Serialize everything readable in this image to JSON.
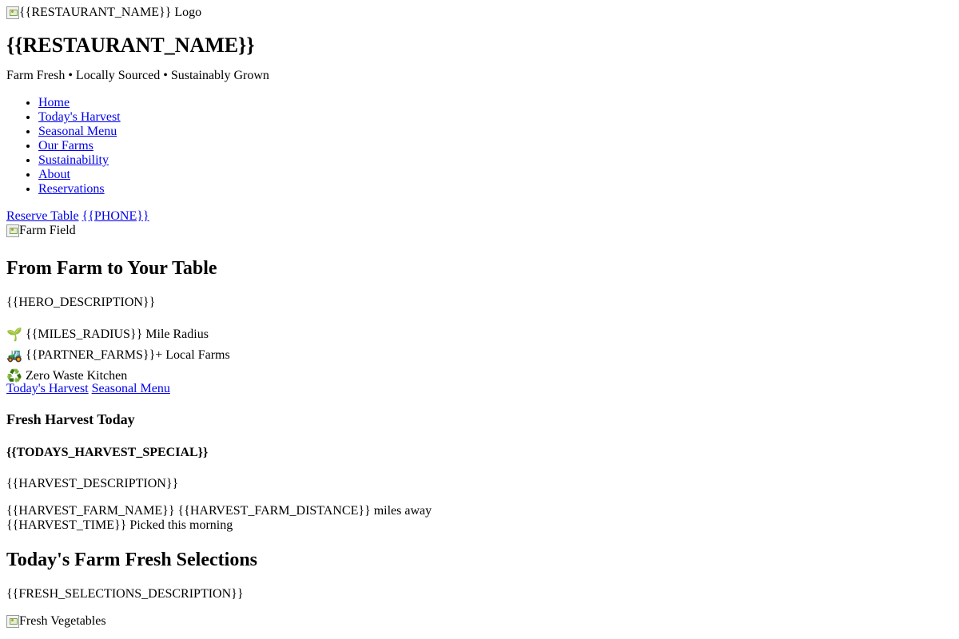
{
  "header": {
    "logo_alt": "{{RESTAURANT_NAME}} Logo",
    "restaurant_name": "{{RESTAURANT_NAME}}",
    "tagline": "Farm Fresh • Locally Sourced • Sustainably Grown",
    "nav": [
      {
        "label": "Home"
      },
      {
        "label": "Today's Harvest"
      },
      {
        "label": "Seasonal Menu"
      },
      {
        "label": "Our Farms"
      },
      {
        "label": "Sustainability"
      },
      {
        "label": "About"
      },
      {
        "label": "Reservations"
      }
    ],
    "reserve_label": "Reserve Table",
    "phone_label": "{{PHONE}}"
  },
  "hero": {
    "image_alt": "Farm Field",
    "title": "From Farm to Your Table",
    "description": "{{HERO_DESCRIPTION}}",
    "features": [
      {
        "icon": "🌱",
        "icon_name": "seedling-icon",
        "text": "{{MILES_RADIUS}} Mile Radius"
      },
      {
        "icon": "🚜",
        "icon_name": "tractor-icon",
        "text": "{{PARTNER_FARMS}}+ Local Farms"
      },
      {
        "icon": "♻️",
        "icon_name": "recycle-icon",
        "text": "Zero Waste Kitchen"
      }
    ],
    "cta_primary": "Today's Harvest",
    "cta_secondary": "Seasonal Menu"
  },
  "harvest": {
    "heading": "Fresh Harvest Today",
    "special": "{{TODAYS_HARVEST_SPECIAL}}",
    "description": "{{HARVEST_DESCRIPTION}}",
    "farm_name": "{{HARVEST_FARM_NAME}}",
    "farm_distance": "{{HARVEST_FARM_DISTANCE}} miles away",
    "time": "{{HARVEST_TIME}}",
    "time_note": "Picked this morning"
  },
  "selections": {
    "heading": "Today's Farm Fresh Selections",
    "description": "{{FRESH_SELECTIONS_DESCRIPTION}}",
    "image_alt": "Fresh Vegetables"
  }
}
